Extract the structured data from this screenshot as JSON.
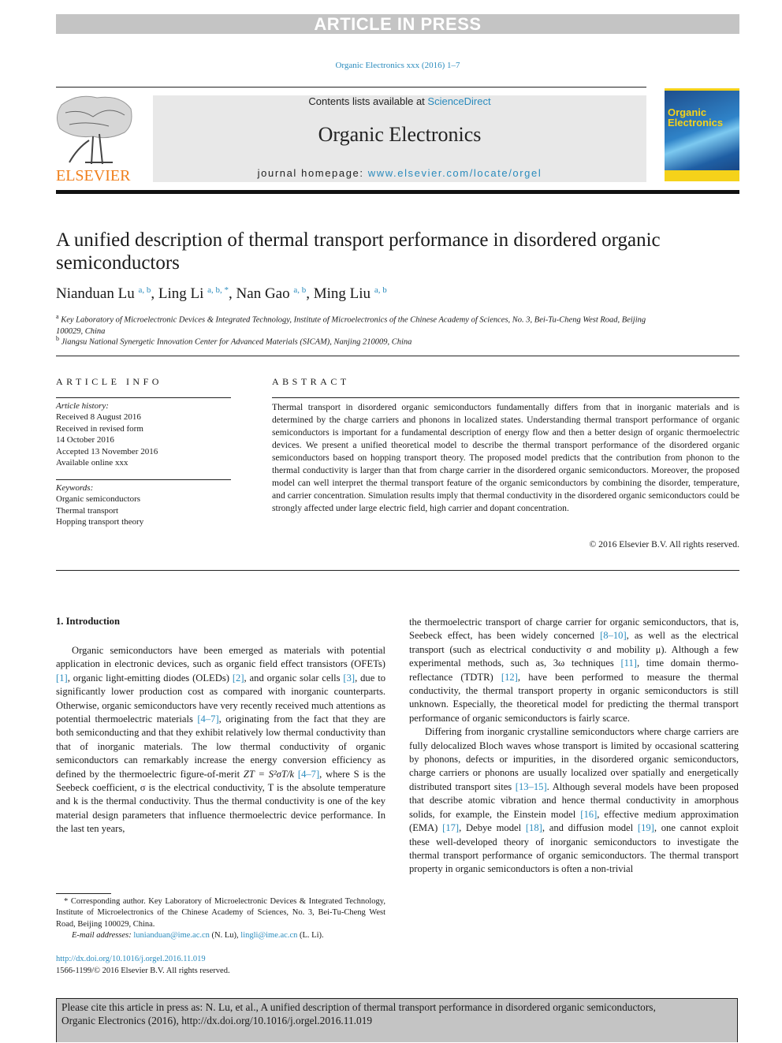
{
  "banner": "ARTICLE IN PRESS",
  "journal_ref": "Organic Electronics xxx (2016) 1–7",
  "header": {
    "contents_prefix": "Contents lists available at ",
    "contents_link": "ScienceDirect",
    "journal_name": "Organic Electronics",
    "homepage_prefix": "journal homepage: ",
    "homepage_link": "www.elsevier.com/locate/orgel",
    "publisher_logo_text": "ELSEVIER",
    "cover_title_1": "Organic",
    "cover_title_2": "Electronics"
  },
  "article": {
    "title": "A unified description of thermal transport performance in disordered organic semiconductors",
    "authors": [
      {
        "name": "Nianduan Lu",
        "affil": "a, b"
      },
      {
        "name": "Ling Li",
        "affil": "a, b, *"
      },
      {
        "name": "Nan Gao",
        "affil": "a, b"
      },
      {
        "name": "Ming Liu",
        "affil": "a, b"
      }
    ],
    "affiliations": [
      {
        "mark": "a",
        "text": "Key Laboratory of Microelectronic Devices & Integrated Technology, Institute of Microelectronics of the Chinese Academy of Sciences, No. 3, Bei-Tu-Cheng West Road, Beijing 100029, China"
      },
      {
        "mark": "b",
        "text": "Jiangsu National Synergetic Innovation Center for Advanced Materials (SICAM), Nanjing 210009, China"
      }
    ]
  },
  "article_info": {
    "heading": "ARTICLE INFO",
    "history_label": "Article history:",
    "history": [
      "Received 8 August 2016",
      "Received in revised form",
      "14 October 2016",
      "Accepted 13 November 2016",
      "Available online xxx"
    ],
    "keywords_label": "Keywords:",
    "keywords": [
      "Organic semiconductors",
      "Thermal transport",
      "Hopping transport theory"
    ]
  },
  "abstract": {
    "heading": "ABSTRACT",
    "body": "Thermal transport in disordered organic semiconductors fundamentally differs from that in inorganic materials and is determined by the charge carriers and phonons in localized states. Understanding thermal transport performance of organic semiconductors is important for a fundamental description of energy flow and then a better design of organic thermoelectric devices. We present a unified theoretical model to describe the thermal transport performance of the disordered organic semiconductors based on hopping transport theory. The proposed model predicts that the contribution from phonon to the thermal conductivity is larger than that from charge carrier in the disordered organic semiconductors. Moreover, the proposed model can well interpret the thermal transport feature of the organic semiconductors by combining the disorder, temperature, and carrier concentration. Simulation results imply that thermal conductivity in the disordered organic semiconductors could be strongly affected under large electric field, high carrier and dopant concentration.",
    "copyright": "© 2016 Elsevier B.V. All rights reserved."
  },
  "intro": {
    "heading": "1.  Introduction",
    "left_p1": [
      "Organic semiconductors have been emerged as materials with potential application in electronic devices, such as organic field effect transistors (OFETs) ",
      "[1]",
      ", organic light-emitting diodes (OLEDs) ",
      "[2]",
      ", and organic solar cells ",
      "[3]",
      ", due to significantly lower production cost as compared with inorganic counterparts. Otherwise, organic semiconductors have very recently received much attentions as potential thermoelectric materials ",
      "[4–7]",
      ", originating from the fact that they are both semiconducting and that they exhibit relatively low thermal conductivity than that of inorganic materials. The low thermal conductivity of organic semiconductors can remarkably increase the energy conversion efficiency as defined by the thermoelectric figure-of-merit ",
      "ZT = S²σT/k",
      " ",
      "[4–7]",
      ", where S is the Seebeck coefficient, σ is the electrical conductivity, T is the absolute temperature and k is the thermal conductivity. Thus the thermal conductivity is one of the key material design parameters that influence thermoelectric device performance. In the last ten years,"
    ],
    "right_p1": [
      "the thermoelectric transport of charge carrier for organic semiconductors, that is, Seebeck effect, has been widely concerned ",
      "[8–10]",
      ", as well as the electrical transport (such as electrical conductivity σ and mobility μ). Although a few experimental methods, such as, 3ω techniques ",
      "[11]",
      ", time domain thermo-reflectance (TDTR) ",
      "[12]",
      ", have been performed to measure the thermal conductivity, the thermal transport property in organic semiconductors is still unknown. Especially, the theoretical model for predicting the thermal transport performance of organic semiconductors is fairly scarce."
    ],
    "right_p2": [
      "Differing from inorganic crystalline semiconductors where charge carriers are fully delocalized Bloch waves whose transport is limited by occasional scattering by phonons, defects or impurities, in the disordered organic semiconductors, charge carriers or phonons are usually localized over spatially and energetically distributed transport sites ",
      "[13–15]",
      ". Although several models have been proposed that describe atomic vibration and hence thermal conductivity in amorphous solids, for example, the Einstein model ",
      "[16]",
      ", effective medium approximation (EMA) ",
      "[17]",
      ", Debye model ",
      "[18]",
      ", and diffusion model ",
      "[19]",
      ", one cannot exploit these well-developed theory of inorganic semiconductors to investigate the thermal transport performance of organic semiconductors. The thermal transport property in organic semiconductors is often a non-trivial"
    ]
  },
  "footnote": {
    "corresponding": "* Corresponding author. Key Laboratory of Microelectronic Devices & Integrated Technology, Institute of Microelectronics of the Chinese Academy of Sciences, No. 3, Bei-Tu-Cheng West Road, Beijing 100029, China.",
    "email_label": "E-mail addresses:",
    "email1": "lunianduan@ime.ac.cn",
    "email1_who": " (N. Lu), ",
    "email2": "lingli@ime.ac.cn",
    "email2_who": " (L. Li).",
    "doi": "http://dx.doi.org/10.1016/j.orgel.2016.11.019",
    "issn": "1566-1199/© 2016 Elsevier B.V. All rights reserved."
  },
  "cite_box": {
    "line1": "Please cite this article in press as: N. Lu, et al., A unified description of thermal transport performance in disordered organic semiconductors,",
    "line2": "Organic Electronics (2016), http://dx.doi.org/10.1016/j.orgel.2016.11.019"
  }
}
